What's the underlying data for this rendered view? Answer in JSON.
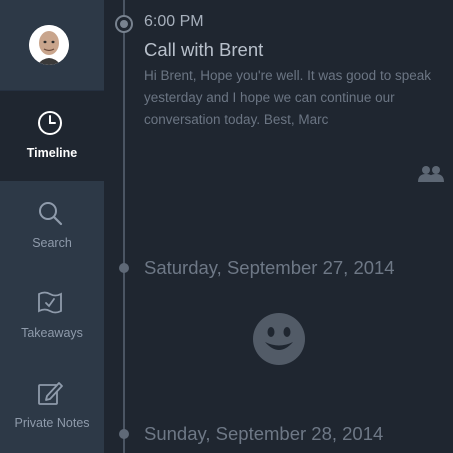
{
  "sidebar": {
    "items": [
      {
        "label": "Timeline",
        "icon": "clock-icon",
        "active": true
      },
      {
        "label": "Search",
        "icon": "magnifier-icon",
        "active": false
      },
      {
        "label": "Takeaways",
        "icon": "flag-check-icon",
        "active": false
      },
      {
        "label": "Private Notes",
        "icon": "pencil-edit-icon",
        "active": false
      }
    ]
  },
  "timeline": {
    "event": {
      "time": "6:00 PM",
      "title": "Call with Brent",
      "body": "Hi Brent, Hope you're well. It was good to speak yesterday and I hope we can continue our conversation today. Best, Marc",
      "attendees_icon": "people-icon"
    },
    "dates": [
      {
        "label": "Saturday, September 27, 2014",
        "empty_icon": "smiley-icon"
      },
      {
        "label": "Sunday, September 28, 2014"
      }
    ]
  },
  "colors": {
    "sidebar_bg": "#2d3947",
    "main_bg": "#1f2630",
    "active_text": "#ffffff",
    "muted_text": "#8f9bab"
  }
}
